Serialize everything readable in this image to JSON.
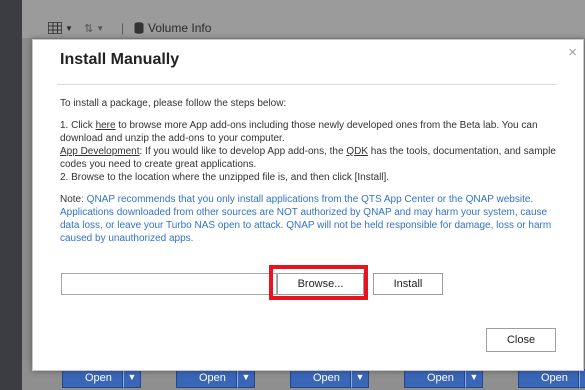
{
  "toolbar": {
    "view_icon": "grid-view-icon",
    "sort_icon": "sort-icon",
    "volume_icon": "database-icon",
    "volume_info_label": "Volume Info"
  },
  "background_buttons": {
    "open_label": "Open",
    "count": 5
  },
  "dialog": {
    "title": "Install Manually",
    "intro": "To install a package, please follow the steps below:",
    "step1_prefix": "1. Click ",
    "step1_link": "here",
    "step1_suffix": " to browse more App add-ons including those newly developed ones from the Beta lab. You can download and unzip the add-ons to your computer.",
    "appdev_link": "App Development",
    "appdev_mid": ": If you would like to develop App add-ons, the ",
    "qdk_link": "QDK",
    "appdev_suffix": " has the tools, documentation, and sample codes you need to create great applications.",
    "step2": "2. Browse to the location where the unzipped file is, and then click [Install].",
    "note_label": "Note",
    "note_text": ": QNAP recommends that you only install applications from the QTS App Center or the QNAP website. Applications downloaded from other sources are NOT authorized by QNAP and may harm your system, cause data loss, or leave your Turbo NAS open to attack. QNAP will not be held responsible for damage, loss or harm caused by unauthorized apps.",
    "file_value": "",
    "browse_label": "Browse...",
    "install_label": "Install",
    "close_label": "Close",
    "close_x": "×"
  },
  "colors": {
    "highlight": "#e8131f",
    "note": "#3273c9",
    "button_blue": "#3a66b8"
  }
}
